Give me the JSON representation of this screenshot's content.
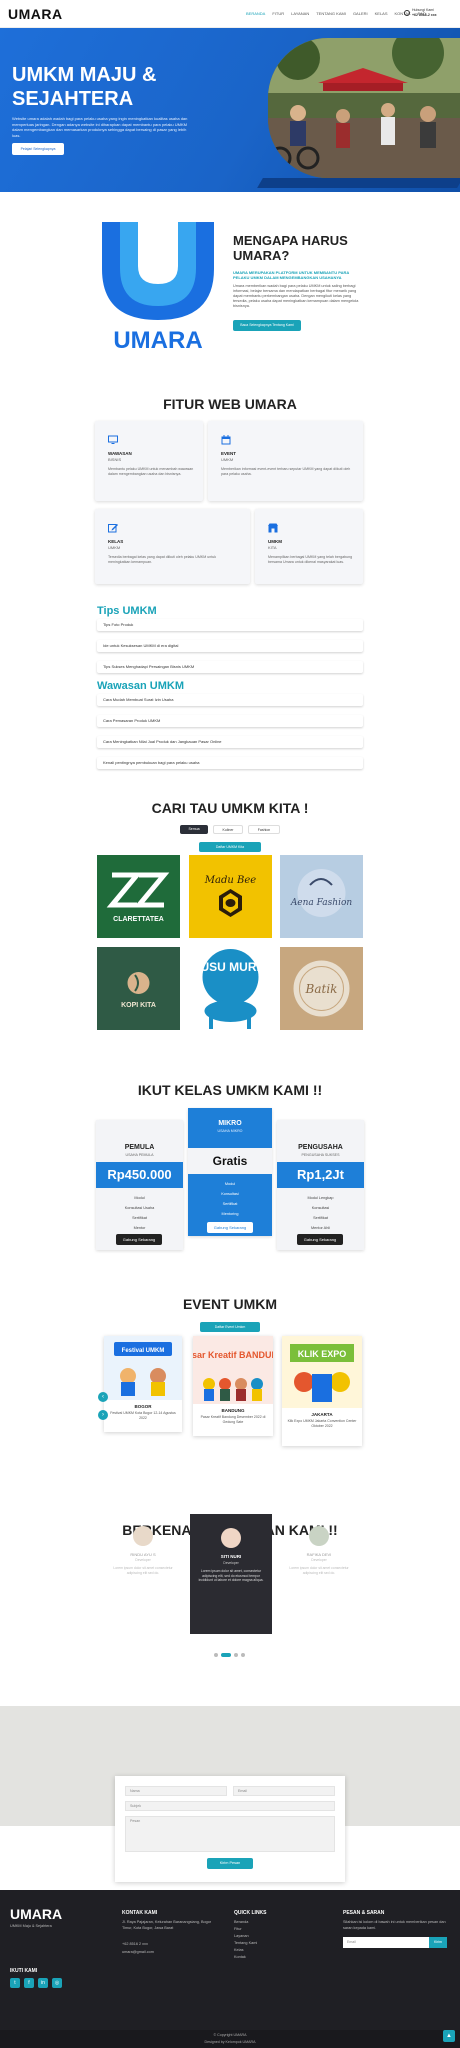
{
  "header": {
    "logo": "UMARA",
    "nav": [
      "Beranda",
      "Fitur",
      "Layanan",
      "Tentang Kami",
      "Galeri",
      "Kelas",
      "Kontak",
      "FAQ"
    ],
    "phone_label": "Hubungi Kami",
    "phone": "+62 8516-2 xxx"
  },
  "hero": {
    "title": "UMKM MAJU & SEJAHTERA",
    "desc": "Website umara adalah wadah bagi para pelaku usaha yang ingin meningkatkan kualitas usaha dan memperluas jaringan. Dengan adanya website ini diharapkan dapat membantu para pelaku UMKM dalam mengembangkan dan memasarkan produknya sehingga dapat bersaing di pasar yang lebih luas.",
    "button": "Pelajari Selengkapnya"
  },
  "why": {
    "logo_text": "UMARA",
    "title": "MENGAPA HARUS UMARA?",
    "subtitle": "UMARA MERUPAKAN PLATFORM UNTUK MEMBANTU PARA PELAKU UMKM DALAM MENGEMBANGKAN USAHANYA",
    "desc": "Umara memberikan wadah bagi para pelaku UMKM untuk saling berbagi informasi, belajar bersama dan mendapatkan berbagai fitur menarik yang dapat membantu perkembangan usaha. Dengan mengikuti kelas yang tersedia, pelaku usaha dapat meningkatkan kemampuan dalam mengelola bisnisnya.",
    "button": "Baca Selengkapnya Tentang Kami"
  },
  "features": {
    "title": "FITUR WEB UMARA",
    "cards": [
      {
        "icon": "monitor-icon",
        "title": "WAWASAN",
        "sub": "BISNIS",
        "desc": "Membantu pelaku UMKM untuk menambah wawasan dalam mengembangkan usaha dan bisnisnya."
      },
      {
        "icon": "calendar-icon",
        "title": "EVENT",
        "sub": "UMKM",
        "desc": "Memberikan informasi event-event terbaru seputar UMKM yang dapat diikuti oleh para pelaku usaha."
      },
      {
        "icon": "edit-icon",
        "title": "KELAS",
        "sub": "UMKM",
        "desc": "Tersedia berbagai kelas yang dapat diikuti oleh pelaku UMKM untuk meningkatkan kemampuan."
      },
      {
        "icon": "store-icon",
        "title": "UMKM",
        "sub": "KITA",
        "desc": "Menampilkan berbagai UMKM yang telah bergabung bersama Umara untuk dikenal masyarakat luas."
      }
    ]
  },
  "tips": {
    "title": "Tips UMKM",
    "items": [
      "Tips Foto Produk",
      "Ide untuk Kesuksesan UMKM di era digital",
      "Tips Sukses Menghadapi Persaingan Bisnis UMKM"
    ]
  },
  "wawasan": {
    "title": "Wawasan UMKM",
    "items": [
      "Cara Mudah Membuat Surat Izin Usaha",
      "Cara Pemasaran Produk UMKM",
      "Cara Meningkatkan Nilai Jual Produk dan Jangkauan Pasar Online",
      "Kenali pentingnya pembukuan bagi para pelaku usaha"
    ]
  },
  "cari": {
    "title": "CARI TAU UMKM KITA !",
    "tabs": [
      "Semua",
      "Kuliner",
      "Fashion"
    ],
    "badge": "Daftar UMKM Kita",
    "brands": [
      {
        "name": "CLARETTATEA",
        "mark": "ZZ",
        "bg": "#1f6b3a",
        "fg": "#ffffff"
      },
      {
        "name": "Madu Bee",
        "mark": "Madu Bee",
        "bg": "#f2c200",
        "fg": "#2a1d0a"
      },
      {
        "name": "Aena Fashion",
        "mark": "Aena Fashion",
        "bg": "#b7cde2",
        "fg": "#3a4a6a"
      },
      {
        "name": "KOPI KITA",
        "mark": "KOPI KITA",
        "bg": "#2f5a45",
        "fg": "#f0e7d2"
      },
      {
        "name": "SUSU MURNI NATURAL",
        "mark": "SUSU MURNI",
        "bg": "#ffffff",
        "fg": "#1a8fc6"
      },
      {
        "name": "Batik",
        "mark": "Batik",
        "bg": "#c7a77f",
        "fg": "#ffffff"
      }
    ]
  },
  "pricing": {
    "title": "IKUT KELAS UMKM KAMI !!",
    "plans": [
      {
        "name": "PEMULA",
        "sub": "USAHA PEMULA",
        "price": "Rp450.000",
        "features": [
          "Modul",
          "Konsultasi Usaha",
          "Sertifikat",
          "Mentor"
        ],
        "button": "Gabung Sekarang"
      },
      {
        "name": "MIKRO",
        "sub": "USAHA MIKRO",
        "price": "Gratis",
        "features": [
          "Modul",
          "Konsultasi",
          "Sertifikat",
          "Mentoring"
        ],
        "button": "Gabung Sekarang"
      },
      {
        "name": "PENGUSAHA",
        "sub": "PENGUSAHA SUKSES",
        "price": "Rp1,2Jt",
        "features": [
          "Modul Lengkap",
          "Konsultasi",
          "Sertifikat",
          "Mentor Ahli"
        ],
        "button": "Gabung Sekarang"
      }
    ]
  },
  "events": {
    "title": "EVENT UMKM",
    "badge": "Daftar Event Umkm",
    "cards": [
      {
        "poster": "Festival UMKM",
        "title": "BOGOR",
        "desc": "Festival UMKM Kota Bogor 12-14 Agustus 2022"
      },
      {
        "poster": "Pasar Kreatif BANDUNG",
        "title": "BANDUNG",
        "desc": "Pasar Kreatif Bandung Desember 2022 di Gedung Sate"
      },
      {
        "poster": "KLIK EXPO",
        "title": "JAKARTA",
        "desc": "Klik Expo UMKM Jakarta Convention Center Oktober 2022"
      }
    ]
  },
  "team": {
    "title": "BERKENALAN DENGAN KAMI !!",
    "members": [
      {
        "name": "RINDU AYU S",
        "role": "Developer",
        "desc": "Lorem ipsum dolor sit amet consectetur adipiscing elit sed do."
      },
      {
        "name": "SITI NURI",
        "role": "Developer",
        "desc": "Lorem ipsum dolor sit amet, consectetur adipiscing elit, sed do eiusmod tempor incididunt ut labore et dolore magna aliqua."
      },
      {
        "name": "RAFIKA DEVI",
        "role": "Developer",
        "desc": "Lorem ipsum dolor sit amet consectetur adipiscing elit sed do."
      }
    ]
  },
  "contact": {
    "name_ph": "Nama",
    "email_ph": "Email",
    "subject_ph": "Subjek",
    "message_ph": "Pesan",
    "button": "Kirim Pesan"
  },
  "footer": {
    "logo": "UMARA",
    "tagline": "UMKM Maju & Sejahtera",
    "follow": "Ikuti Kami",
    "contact_title": "KONTAK KAMI",
    "address": "Jl. Raya Pajajaran, Kelurahan Baranangsiang, Bogor Timur, Kota Bogor, Jawa Barat",
    "phone": "+62 8516 2 xxx",
    "email": "umara@gmail.com",
    "links_title": "QUICK LINKS",
    "links": [
      "Beranda",
      "Fitur",
      "Layanan",
      "Tentang Kami",
      "Kelas",
      "Kontak"
    ],
    "news_title": "PESAN & SARAN",
    "news_desc": "Silahkan isi kolom di bawah ini untuk memberikan pesan dan saran kepada kami.",
    "news_ph": "Email",
    "news_btn": "Kirim",
    "copyright": "© Copyright UMARA",
    "credit": "Designed by Kelompok UMARA"
  }
}
